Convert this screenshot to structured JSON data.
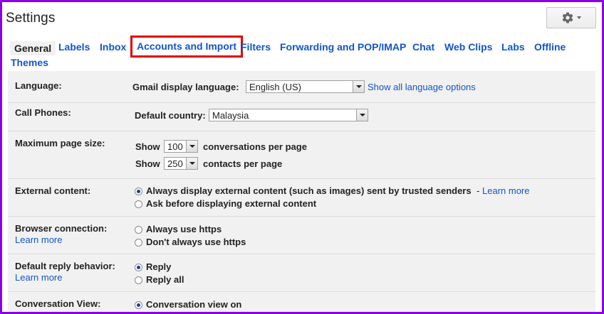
{
  "header": {
    "title": "Settings",
    "settings_icon": "gear-icon"
  },
  "tabs": [
    {
      "label": "General",
      "active": true
    },
    {
      "label": "Labels"
    },
    {
      "label": "Inbox"
    },
    {
      "label": "Accounts and Import",
      "highlighted": true
    },
    {
      "label": "Filters"
    },
    {
      "label": "Forwarding and POP/IMAP"
    },
    {
      "label": "Chat"
    },
    {
      "label": "Web Clips"
    },
    {
      "label": "Labs"
    },
    {
      "label": "Offline"
    },
    {
      "label": "Themes"
    }
  ],
  "settings": {
    "language": {
      "label": "Language:",
      "field_label": "Gmail display language:",
      "value": "English (US)",
      "link": "Show all language options"
    },
    "call_phones": {
      "label": "Call Phones:",
      "field_label": "Default country:",
      "value": "Malaysia"
    },
    "page_size": {
      "label": "Maximum page size:",
      "show_label": "Show",
      "conversations_value": "100",
      "conversations_suffix": "conversations per page",
      "contacts_value": "250",
      "contacts_suffix": "contacts per page"
    },
    "external_content": {
      "label": "External content:",
      "option1": "Always display external content (such as images) sent by trusted senders",
      "separator": "-",
      "learn_more": "Learn more",
      "option2": "Ask before displaying external content"
    },
    "browser_connection": {
      "label": "Browser connection:",
      "learn_more": "Learn more",
      "option1": "Always use https",
      "option2": "Don't always use https"
    },
    "reply_behavior": {
      "label": "Default reply behavior:",
      "learn_more": "Learn more",
      "option1": "Reply",
      "option2": "Reply all"
    },
    "conversation_view": {
      "label": "Conversation View:",
      "option1": "Conversation view on"
    }
  },
  "colors": {
    "frame_border": "#8a00e6",
    "highlight_border": "#e00000",
    "link": "#1155cc",
    "panel_bg": "#f1f1f1"
  }
}
